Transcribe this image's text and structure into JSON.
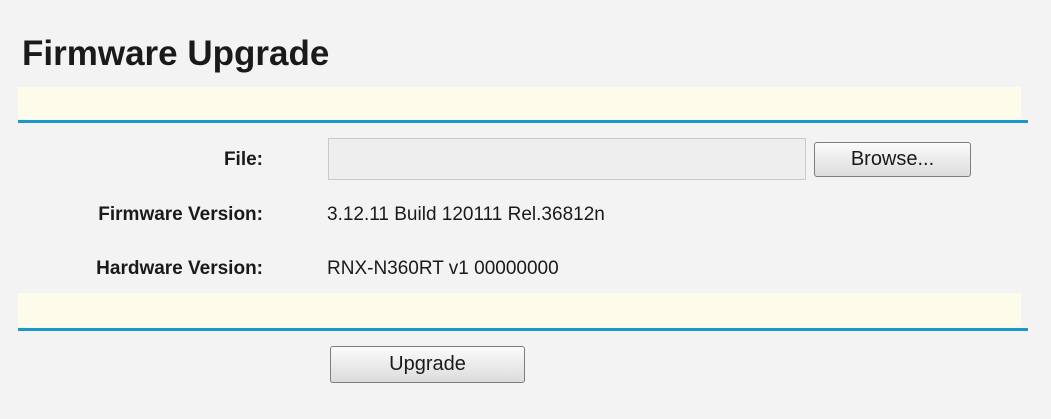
{
  "page": {
    "title": "Firmware Upgrade"
  },
  "form": {
    "file_label": "File:",
    "file_value": "",
    "browse_label": "Browse...",
    "firmware_label": "Firmware Version:",
    "firmware_value": "3.12.11 Build 120111 Rel.36812n",
    "hardware_label": "Hardware Version:",
    "hardware_value": "RNX-N360RT v1 00000000",
    "upgrade_label": "Upgrade"
  },
  "colors": {
    "accent_rule": "#1e96c6",
    "band_background": "#fdfbea",
    "page_background": "#f3f3f3"
  }
}
